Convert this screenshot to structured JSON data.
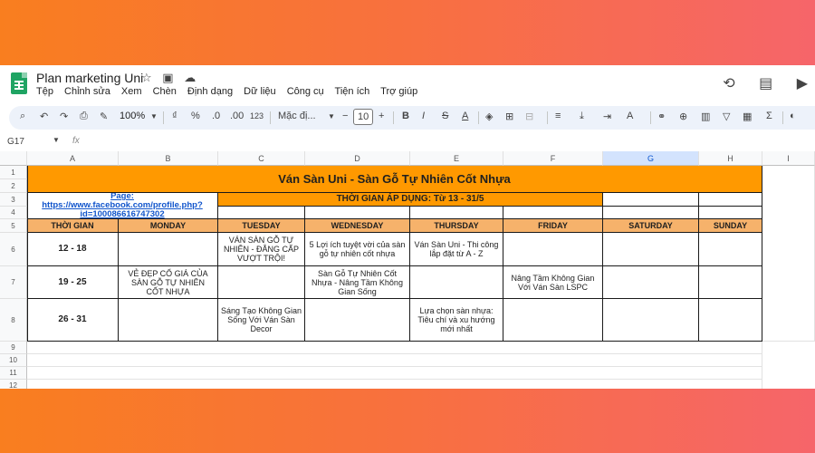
{
  "window": {
    "title": "Plan marketing Uni",
    "menu": [
      "Tệp",
      "Chỉnh sửa",
      "Xem",
      "Chèn",
      "Định dạng",
      "Dữ liệu",
      "Công cụ",
      "Tiện ích",
      "Trợ giúp"
    ]
  },
  "toolbar": {
    "zoom": "100%",
    "currency": "₫",
    "percent": "%",
    "dec_less": ".0",
    "dec_more": ".00",
    "num_format": "123",
    "font": "Mặc đị...",
    "font_size": "10"
  },
  "formula_bar": {
    "cell_ref": "G17",
    "fx": "fx"
  },
  "columns": [
    "A",
    "B",
    "C",
    "D",
    "E",
    "F",
    "G",
    "H",
    "I"
  ],
  "rows": [
    "1",
    "2",
    "3",
    "4",
    "5",
    "6",
    "7",
    "8",
    "9",
    "10",
    "11",
    "12"
  ],
  "sheet": {
    "title": "Ván Sàn Uni - Sàn Gỗ Tự Nhiên Cốt Nhựa",
    "page_link": "Page: https://www.facebook.com/profile.php?id=100086616747302",
    "period": "THỜI GIAN ÁP DỤNG: Từ 13 - 31/5",
    "headers": [
      "THỜI GIAN",
      "MONDAY",
      "TUESDAY",
      "WEDNESDAY",
      "THURSDAY",
      "FRIDAY",
      "SATURDAY",
      "SUNDAY"
    ],
    "schedule": [
      {
        "time": "12 - 18",
        "tuesday": "VÁN SÀN GỖ TỰ NHIÊN - ĐẲNG CẤP VƯỢT TRỘI!",
        "wednesday": "5 Lợi ích tuyệt vời của sàn gỗ tự nhiên cốt nhựa",
        "thursday": "Ván Sàn Uni - Thi công lắp đặt từ A - Z"
      },
      {
        "time": "19 - 25",
        "monday": "VẺ ĐẸP CỔ GIÁ CỦA SÀN GỖ TỰ NHIÊN CỐT NHỰA",
        "wednesday": "Sàn Gỗ Tự Nhiên Cốt Nhựa - Nâng Tầm Không Gian Sống",
        "friday": "Nâng Tầm Không Gian Với Ván Sàn LSPC"
      },
      {
        "time": "26 - 31",
        "tuesday": "Sáng Tạo Không Gian Sống Với Ván Sàn Decor",
        "thursday": "Lựa chọn sàn nhựa: Tiêu chí và xu hướng mới nhất"
      }
    ]
  }
}
